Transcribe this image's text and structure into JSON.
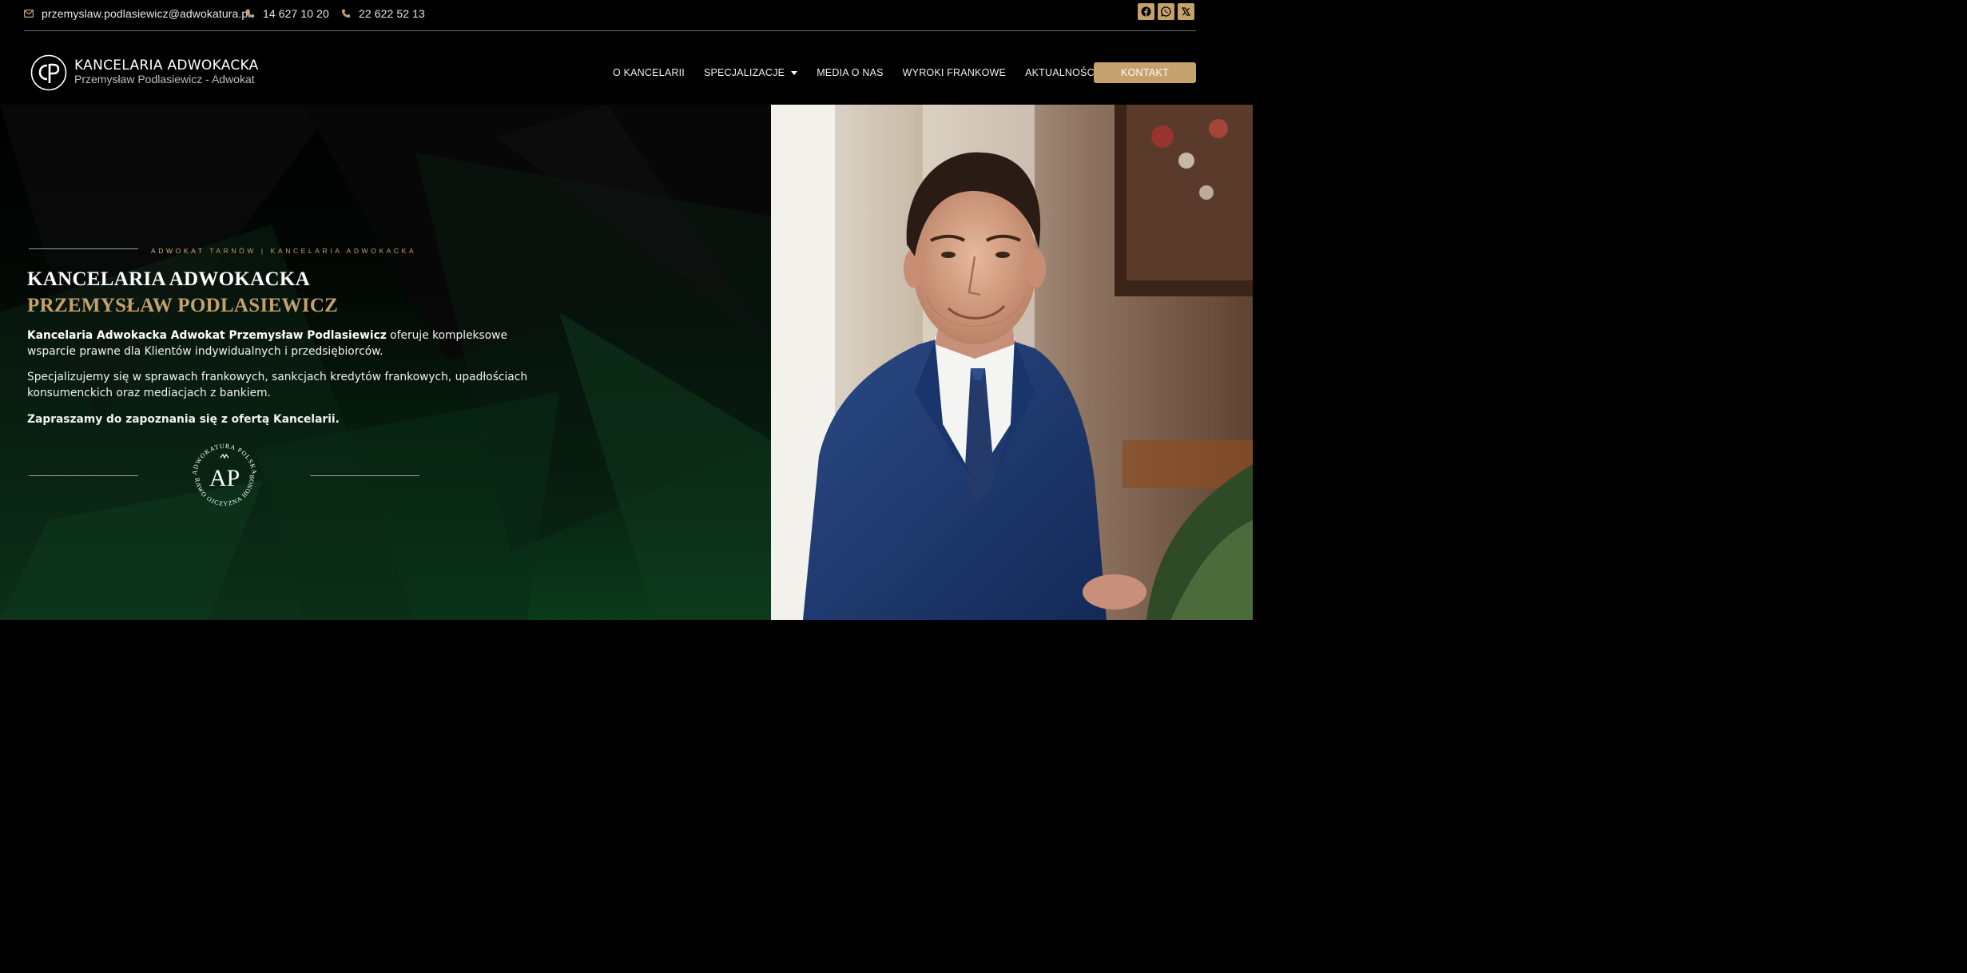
{
  "topbar": {
    "email": "przemyslaw.podlasiewicz@adwokatura.pl",
    "phone_1": "14 627 10 20",
    "phone_2": "22 622 52 13",
    "social": [
      "facebook-icon",
      "whatsapp-icon",
      "x-icon"
    ]
  },
  "header": {
    "brand_title": "KANCELARIA ADWOKACKA",
    "brand_subtitle": "Przemysław Podlasiewicz - Adwokat",
    "nav": [
      {
        "label": "O KANCELARII"
      },
      {
        "label": "SPECJALIZACJE"
      },
      {
        "label": "MEDIA O NAS"
      },
      {
        "label": "WYROKI FRANKOWE"
      },
      {
        "label": "AKTUALNOŚCI"
      }
    ],
    "cta_label": "KONTAKT"
  },
  "hero": {
    "eyebrow_strong": "ADWOKAT",
    "eyebrow_rest": " TARNÓW  |  KANCELARIA ADWOKACKA",
    "title_line_1": "KANCELARIA ADWOKACKA",
    "title_line_2": "PRZEMYSŁAW PODLASIEWICZ",
    "para_1_bold": "Kancelaria Adwokacka Adwokat Przemysław Podlasiewicz",
    "para_1_rest": " oferuje kompleksowe wsparcie prawne dla Klientów indywidualnych i przedsiębiorców.",
    "para_2": "Specjalizujemy się w sprawach frankowych, sankcjach kredytów frankowych, upadłościach konsumenckich oraz mediacjach z bankiem.",
    "para_3": "Zapraszamy do zapoznania się z ofertą Kancelarii.",
    "seal_top_text": "ADWOKATURA POLSKA",
    "seal_bottom_text": "PRAWO OJCZYZNA HONOR",
    "seal_monogram": "AP"
  },
  "logo_monogram": "cP",
  "colors": {
    "gold": "#c5a16b",
    "background": "#000000",
    "hero_green": "#0b3a1c",
    "suit_navy": "#1e3a6e"
  }
}
